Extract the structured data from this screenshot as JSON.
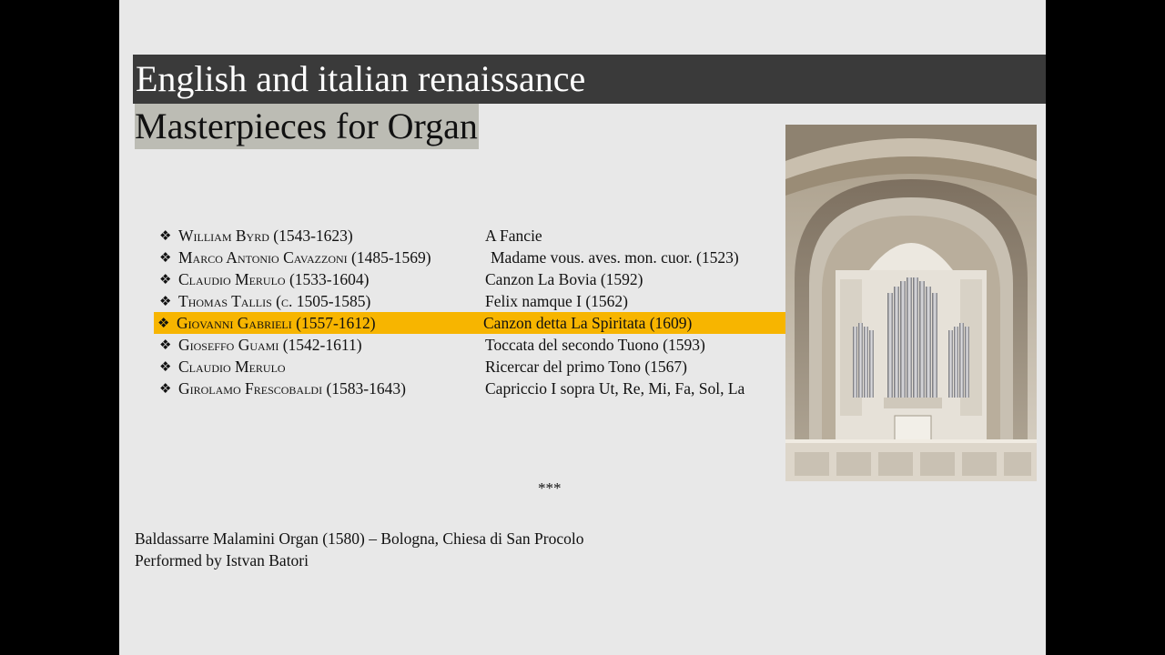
{
  "slide": {
    "title": "English and italian renaissance",
    "subtitle": "Masterpieces for Organ",
    "bullet_glyph": "❖",
    "tracks": [
      {
        "composer": "William Byrd (1543-1623)",
        "piece": "A Fancie"
      },
      {
        "composer": "Marco Antonio Cavazzoni (1485-1569)",
        "piece": "Madame vous. aves. mon. cuor. (1523)"
      },
      {
        "composer": "Claudio Merulo (1533-1604)",
        "piece": "Canzon La Bovia (1592)"
      },
      {
        "composer": "Thomas Tallis (c. 1505-1585)",
        "piece": "Felix namque I (1562)"
      },
      {
        "composer": "Giovanni Gabrieli (1557-1612)",
        "piece": "Canzon detta La Spiritata (1609)"
      },
      {
        "composer": "Gioseffo Guami (1542-1611)",
        "piece": "Toccata del secondo Tuono (1593)"
      },
      {
        "composer": "Claudio Merulo",
        "piece": "Ricercar del primo Tono (1567)"
      },
      {
        "composer": "Girolamo Frescobaldi (1583-1643)",
        "piece": "Capriccio I sopra Ut, Re, Mi, Fa, Sol, La"
      }
    ],
    "separator": "***",
    "credit_line1": "Baldassarre Malamini Organ (1580) – Bologna, Chiesa di San Procolo",
    "credit_line2": "Performed by Istvan Batori"
  },
  "colors": {
    "title_bar": "#3a3a3a",
    "subtitle_highlight": "#bcbcb4",
    "track_highlight": "#f7b500",
    "slide_background": "#e8e8e8",
    "letterbox": "#000000"
  },
  "icons": {
    "bullet": "four-petal-diamond-icon",
    "photo": "church-organ-photo"
  }
}
